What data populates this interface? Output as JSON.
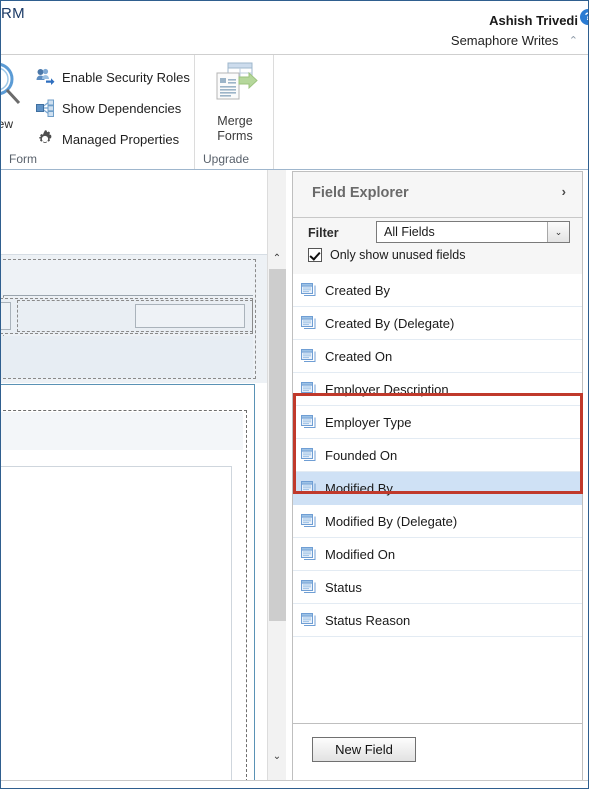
{
  "app": {
    "logo_text": "RM"
  },
  "topbar": {
    "user_name": "Ashish Trivedi",
    "organization": "Semaphore Writes",
    "help_icon": "question-mark-icon",
    "help_glyph": "?",
    "org_chevron_glyph": "⌃"
  },
  "ribbon": {
    "groups": [
      {
        "label": "Form"
      },
      {
        "label": "Upgrade"
      }
    ],
    "preview": {
      "label": "view",
      "caret_glyph": "▾",
      "icon": "preview-magnifier-icon"
    },
    "commands": [
      {
        "label": "Enable Security Roles",
        "icon": "security-roles-icon"
      },
      {
        "label": "Show Dependencies",
        "icon": "dependencies-icon"
      },
      {
        "label": "Managed Properties",
        "icon": "gear-icon"
      }
    ],
    "merge_forms": {
      "line1": "Merge",
      "line2": "Forms",
      "icon": "merge-forms-icon"
    }
  },
  "canvas": {
    "scrollbar": {
      "up_glyph": "⌃",
      "down_glyph": "⌄"
    }
  },
  "field_explorer": {
    "title": "Field Explorer",
    "collapse_glyph": "›",
    "filter": {
      "label": "Filter",
      "selected": "All Fields",
      "options": [
        "All Fields"
      ],
      "arrow_glyph": "⌄"
    },
    "checkbox": {
      "label": "Only show unused fields",
      "checked": true
    },
    "fields": [
      {
        "label": "Created By",
        "icon": "field-icon",
        "selected": false,
        "highlighted": false
      },
      {
        "label": "Created By (Delegate)",
        "icon": "field-icon",
        "selected": false,
        "highlighted": false
      },
      {
        "label": "Created On",
        "icon": "field-icon",
        "selected": false,
        "highlighted": false
      },
      {
        "label": "Employer Description",
        "icon": "field-icon",
        "selected": false,
        "highlighted": true
      },
      {
        "label": "Employer Type",
        "icon": "field-icon",
        "selected": false,
        "highlighted": true
      },
      {
        "label": "Founded On",
        "icon": "field-icon",
        "selected": false,
        "highlighted": true
      },
      {
        "label": "Modified By",
        "icon": "field-icon",
        "selected": true,
        "highlighted": false
      },
      {
        "label": "Modified By (Delegate)",
        "icon": "field-icon",
        "selected": false,
        "highlighted": false
      },
      {
        "label": "Modified On",
        "icon": "field-icon",
        "selected": false,
        "highlighted": false
      },
      {
        "label": "Status",
        "icon": "field-icon",
        "selected": false,
        "highlighted": false
      },
      {
        "label": "Status Reason",
        "icon": "field-icon",
        "selected": false,
        "highlighted": false
      }
    ],
    "new_field_button": "New Field"
  },
  "colors": {
    "highlight_red": "#c0392b",
    "selection_blue": "#cfe1f5",
    "help_blue": "#2b7cd3",
    "logo_navy": "#1b3a66",
    "field_icon_blue": "#6f9ed4"
  }
}
